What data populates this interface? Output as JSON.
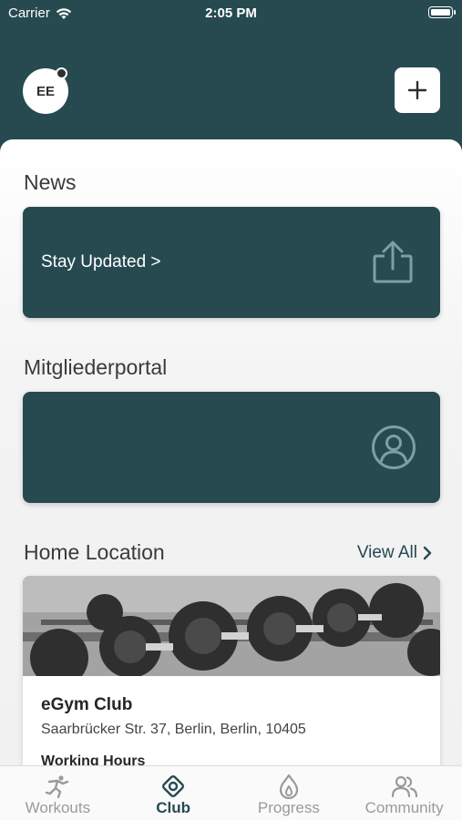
{
  "status_bar": {
    "carrier": "Carrier",
    "time": "2:05 PM"
  },
  "header": {
    "avatar_initials": "EE"
  },
  "sections": {
    "news": {
      "title": "News",
      "card_label": "Stay Updated >"
    },
    "portal": {
      "title": "Mitgliederportal"
    },
    "home_location": {
      "title": "Home Location",
      "view_all": "View All"
    }
  },
  "club": {
    "name": "eGym Club",
    "address": "Saarbrücker Str. 37, Berlin, Berlin, 10405",
    "hours_label": "Working Hours"
  },
  "tabs": [
    {
      "label": "Workouts",
      "icon": "workout-runner-icon",
      "active": false
    },
    {
      "label": "Club",
      "icon": "club-target-icon",
      "active": true
    },
    {
      "label": "Progress",
      "icon": "flame-icon",
      "active": false
    },
    {
      "label": "Community",
      "icon": "people-icon",
      "active": false
    }
  ],
  "colors": {
    "primary": "#264a50",
    "inactive_tab": "#9a9a9a",
    "background": "#f2f2f2"
  }
}
